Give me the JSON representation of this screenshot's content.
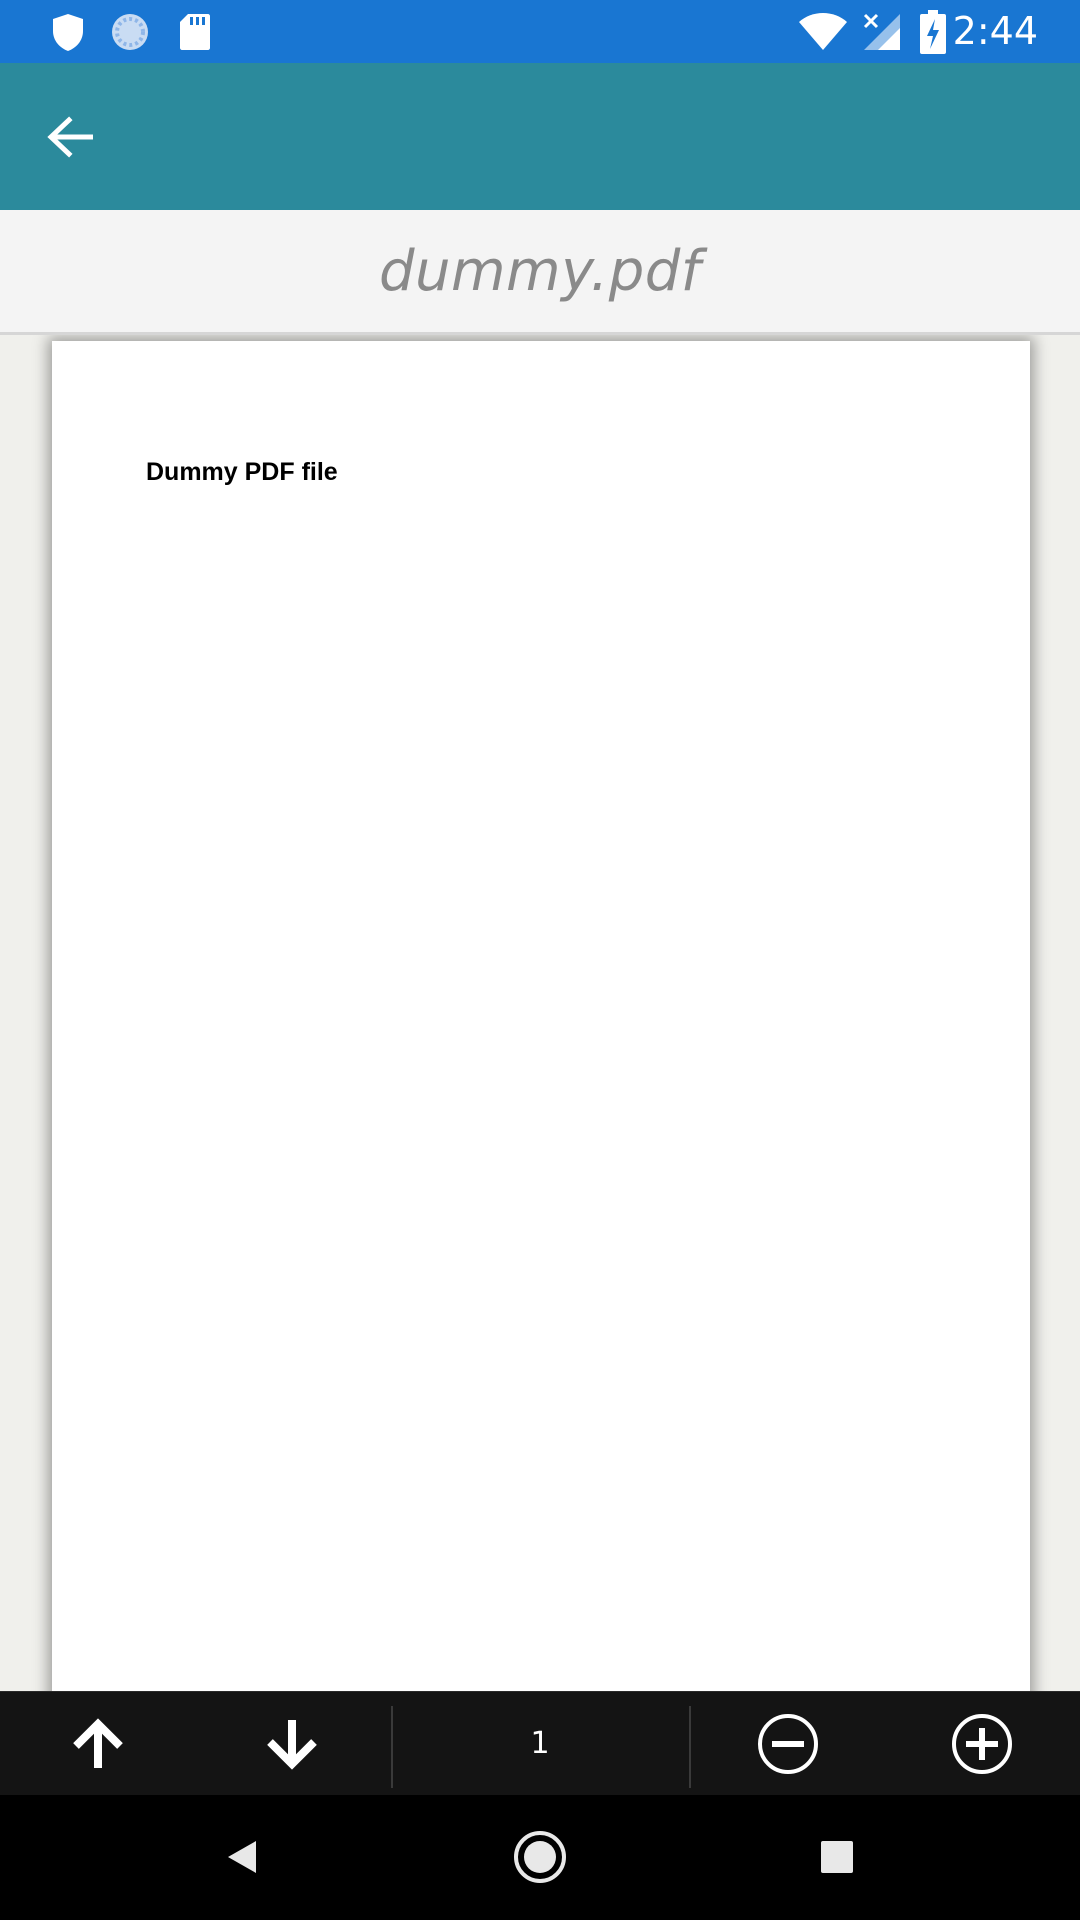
{
  "status_bar": {
    "time": "2:44",
    "background": "#1976d2",
    "left_icons": [
      "shield-icon",
      "sync-icon",
      "sd-card-icon"
    ],
    "right_icons": [
      "wifi-icon",
      "cell-signal-off-icon",
      "battery-charging-icon"
    ]
  },
  "app_bar": {
    "background": "#2b8a9c",
    "back_icon": "arrow-left-icon"
  },
  "document": {
    "file_name": "dummy.pdf",
    "page_heading": "Dummy PDF file"
  },
  "toolbar": {
    "page_number": "1",
    "buttons": [
      "arrow-up-icon",
      "arrow-down-icon",
      "zoom-out-icon",
      "zoom-in-icon"
    ]
  },
  "nav_bar": {
    "buttons": [
      "nav-back-icon",
      "nav-home-icon",
      "nav-recents-icon"
    ]
  }
}
